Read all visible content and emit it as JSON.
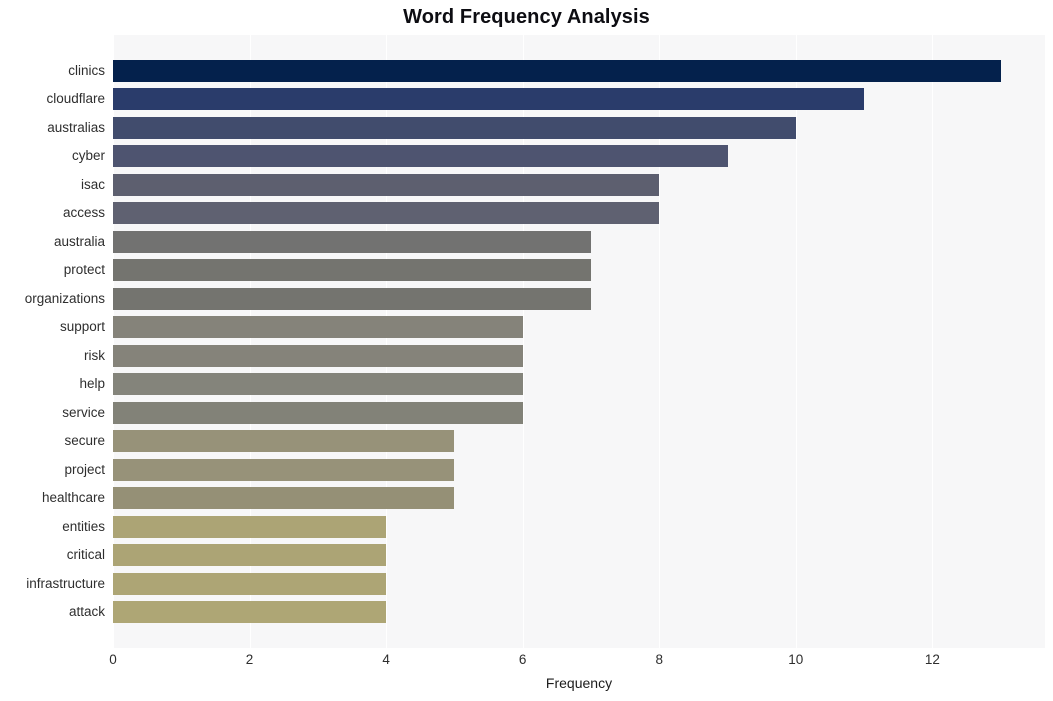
{
  "chart_data": {
    "type": "bar",
    "orientation": "horizontal",
    "title": "Word Frequency Analysis",
    "xlabel": "Frequency",
    "ylabel": "",
    "xlim": [
      0,
      13.65
    ],
    "xticks": [
      0,
      2,
      4,
      6,
      8,
      10,
      12
    ],
    "xticklabels": [
      "0",
      "2",
      "4",
      "6",
      "8",
      "10",
      "12"
    ],
    "grid": true,
    "grid_axis": "x",
    "legend": null,
    "categories": [
      "clinics",
      "cloudflare",
      "australias",
      "cyber",
      "isac",
      "access",
      "australia",
      "protect",
      "organizations",
      "support",
      "risk",
      "help",
      "service",
      "secure",
      "project",
      "healthcare",
      "entities",
      "critical",
      "infrastructure",
      "attack"
    ],
    "values": [
      13,
      11,
      10,
      9,
      8,
      8,
      7,
      7,
      7,
      6,
      6,
      6,
      6,
      5,
      5,
      5,
      4,
      4,
      4,
      4
    ],
    "bar_colors": [
      "#04214c",
      "#2a3c6b",
      "#414c6d",
      "#4e5470",
      "#5d5f6f",
      "#5f6171",
      "#727271",
      "#74746f",
      "#74746f",
      "#85837a",
      "#85837a",
      "#84847b",
      "#828278",
      "#979279",
      "#979279",
      "#959076",
      "#aca475",
      "#aca475",
      "#ada575",
      "#aea675"
    ],
    "plot_background": "#f7f7f8",
    "figure_background": "#ffffff",
    "gridline_color": "#ffffff"
  }
}
